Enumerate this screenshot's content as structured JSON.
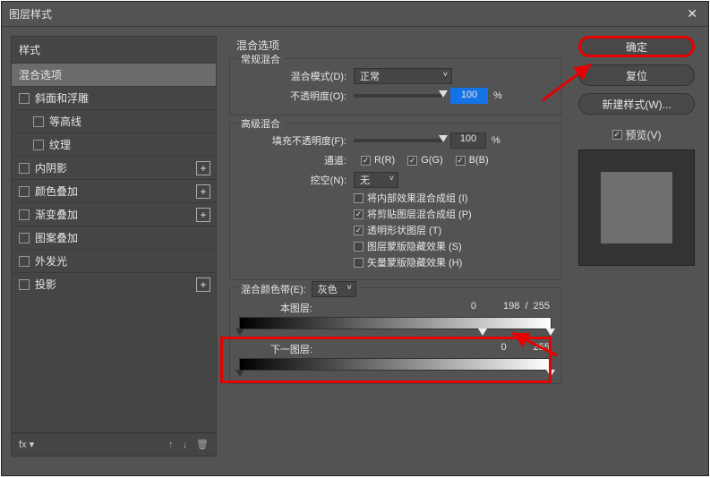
{
  "title": "图层样式",
  "sidebar": {
    "header": "样式",
    "items": [
      {
        "label": "混合选项",
        "selected": true,
        "checkbox": false
      },
      {
        "label": "斜面和浮雕",
        "checkbox": true
      },
      {
        "label": "等高线",
        "checkbox": true,
        "indent": true
      },
      {
        "label": "纹理",
        "checkbox": true,
        "indent": true
      },
      {
        "label": "内阴影",
        "checkbox": true,
        "add": true
      },
      {
        "label": "颜色叠加",
        "checkbox": true,
        "add": true
      },
      {
        "label": "渐变叠加",
        "checkbox": true,
        "add": true
      },
      {
        "label": "图案叠加",
        "checkbox": true
      },
      {
        "label": "外发光",
        "checkbox": true
      },
      {
        "label": "投影",
        "checkbox": true,
        "add": true
      }
    ],
    "fx_label": "fx"
  },
  "center": {
    "group_title": "混合选项",
    "general": {
      "legend": "常规混合",
      "mode_label": "混合模式(D):",
      "mode_value": "正常",
      "opacity_label": "不透明度(O):",
      "opacity_value": "100",
      "pct": "%"
    },
    "advanced": {
      "legend": "高级混合",
      "fill_label": "填充不透明度(F):",
      "fill_value": "100",
      "pct": "%",
      "channels_label": "通道:",
      "channels": [
        "R(R)",
        "G(G)",
        "B(B)"
      ],
      "knockout_label": "挖空(N):",
      "knockout_value": "无",
      "opts": [
        {
          "label": "将内部效果混合成组 (I)",
          "on": false
        },
        {
          "label": "将剪贴图层混合成组 (P)",
          "on": true
        },
        {
          "label": "透明形状图层 (T)",
          "on": true
        },
        {
          "label": "图层蒙版隐藏效果 (S)",
          "on": false
        },
        {
          "label": "矢量蒙版隐藏效果 (H)",
          "on": false
        }
      ]
    },
    "blendif": {
      "legend": "混合颜色带(E):",
      "channel": "灰色",
      "this_label": "本图层:",
      "this_black": "0",
      "this_white_lo": "198",
      "this_white_hi": "255",
      "under_label": "下一图层:",
      "under_black": "0",
      "under_white": "255"
    }
  },
  "right": {
    "ok": "确定",
    "cancel": "复位",
    "newstyle": "新建样式(W)...",
    "preview": "预览(V)"
  }
}
